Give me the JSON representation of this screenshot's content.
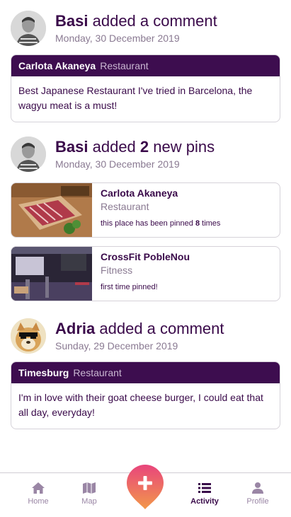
{
  "feed": {
    "activity1": {
      "user": "Basi",
      "action": "added a comment",
      "date": "Monday, 30 December 2019",
      "card": {
        "place": "Carlota Akaneya",
        "category": "Restaurant",
        "comment": "Best Japanese Restaurant I've tried in Barcelona, the wagyu meat is a must!"
      }
    },
    "activity2": {
      "user": "Basi",
      "action_prefix": "added",
      "count": "2",
      "action_suffix": "new pins",
      "date": "Monday, 30 December 2019",
      "pins": [
        {
          "name": "Carlota Akaneya",
          "category": "Restaurant",
          "note_prefix": "this place has been pinned",
          "note_count": "8",
          "note_suffix": "times"
        },
        {
          "name": "CrossFit PobleNou",
          "category": "Fitness",
          "note": "first time pinned!"
        }
      ]
    },
    "activity3": {
      "user": "Adria",
      "action": "added a comment",
      "date": "Sunday, 29 December 2019",
      "card": {
        "place": "Timesburg",
        "category": "Restaurant",
        "comment": "I'm in love with their goat cheese burger, I could eat that all day, everyday!"
      }
    }
  },
  "nav": {
    "home": {
      "label": "Home",
      "icon": "home-icon"
    },
    "map": {
      "label": "Map",
      "icon": "map-icon"
    },
    "add": {
      "icon": "plus-icon"
    },
    "activity": {
      "label": "Activity",
      "icon": "list-icon"
    },
    "profile": {
      "label": "Profile",
      "icon": "person-icon"
    }
  },
  "colors": {
    "brand_dark": "#3d0d4f",
    "muted": "#8a7a92",
    "fab_top": "#e84b7a",
    "fab_bottom": "#f29a4a",
    "nav_inactive": "#9a86a5"
  }
}
